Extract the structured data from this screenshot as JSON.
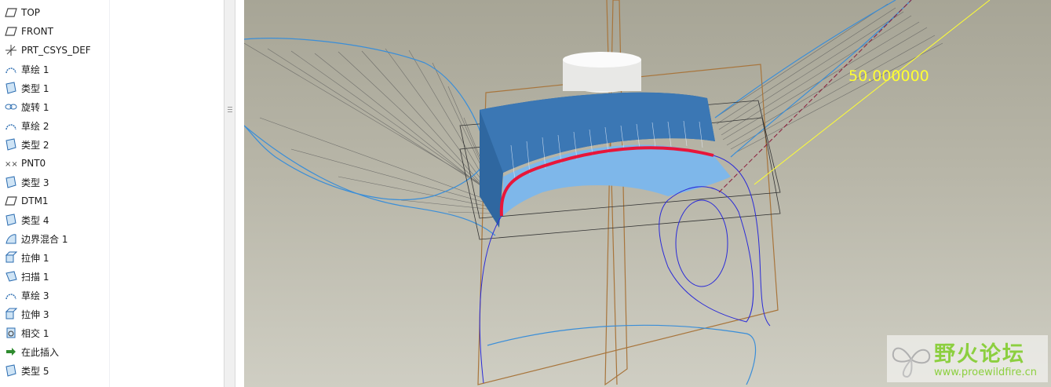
{
  "model_tree": {
    "items": [
      {
        "label": "TOP",
        "icon": "datum-plane-icon"
      },
      {
        "label": "FRONT",
        "icon": "datum-plane-icon"
      },
      {
        "label": "PRT_CSYS_DEF",
        "icon": "csys-icon"
      },
      {
        "label": "草绘 1",
        "icon": "sketch-icon"
      },
      {
        "label": "类型 1",
        "icon": "surface-icon"
      },
      {
        "label": "旋转 1",
        "icon": "revolve-icon"
      },
      {
        "label": "草绘 2",
        "icon": "sketch-icon"
      },
      {
        "label": "类型 2",
        "icon": "surface-icon"
      },
      {
        "label": "PNT0",
        "icon": "datum-point-icon"
      },
      {
        "label": "类型 3",
        "icon": "surface-icon"
      },
      {
        "label": "DTM1",
        "icon": "datum-plane-icon"
      },
      {
        "label": "类型 4",
        "icon": "surface-icon"
      },
      {
        "label": "边界混合 1",
        "icon": "boundary-blend-icon"
      },
      {
        "label": "拉伸 1",
        "icon": "extrude-icon"
      },
      {
        "label": "扫描 1",
        "icon": "sweep-icon"
      },
      {
        "label": "草绘 3",
        "icon": "sketch-icon"
      },
      {
        "label": "拉伸 3",
        "icon": "extrude-icon"
      },
      {
        "label": "相交 1",
        "icon": "intersect-icon"
      },
      {
        "label": "在此插入",
        "icon": "insert-here-arrow-icon"
      },
      {
        "label": "类型 5",
        "icon": "surface-icon"
      }
    ]
  },
  "viewport": {
    "dimension_label": "50.000000",
    "colors": {
      "bg_top": "#a7a596",
      "bg_bottom": "#cfcec3",
      "surface": "#3b77b4",
      "highlight": "#e8163a",
      "datum": "#a8753c",
      "curve": "#2a2ad8",
      "dim": "#ffff33"
    }
  },
  "watermark": {
    "title": "野火论坛",
    "url": "www.proewildfire.cn"
  }
}
